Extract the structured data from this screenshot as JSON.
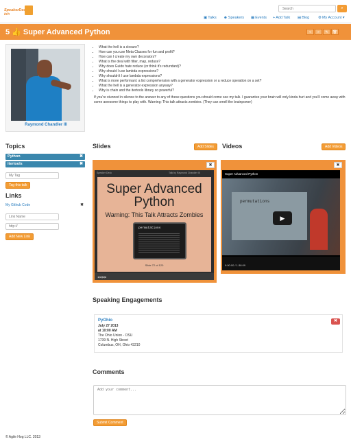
{
  "header": {
    "logo_text": "SpeakerDeck-ish",
    "search_placeholder": "Search",
    "search_icon": "magnifier-icon",
    "nav": [
      {
        "label": "Talks",
        "icon": "comments-icon"
      },
      {
        "label": "Speakers",
        "icon": "users-icon"
      },
      {
        "label": "Events",
        "icon": "calendar-icon"
      },
      {
        "label": "Add Talk",
        "icon": "plus-icon"
      },
      {
        "label": "Blog",
        "icon": "book-icon"
      },
      {
        "label": "My Account",
        "icon": "gear-icon"
      }
    ]
  },
  "title": {
    "text": "5 👍 Super Advanced Python",
    "actions": [
      "«",
      "»",
      "✎",
      "🗑"
    ]
  },
  "speaker": {
    "name": "Raymond Chandler III"
  },
  "abstract": {
    "bullets": [
      "What the hell is a closure?",
      "How can you use Meta Classes for fun and profit?",
      "How can I create my own decorators?",
      "What is the deal with filter, map, reduce?",
      "Why does Guido hate reduce (or think it's redundant)?",
      "Why should I use lambda expressions?",
      "Why shouldn't I use lambda expressions?",
      "What is more performant: a list comprehension with a generator expression or a reduce operation on a set?",
      "What the hell is a generator expression anyway?",
      "Why is chain and the itertools library so powerful?"
    ],
    "paragraph": "If you're stunned in silence to the answer to any of these questions you should come see my talk. I guarantee your brain will only kinda hurt and you'll come away with some awesome things to play with. Warning: This talk attracts zombies. (They can smell the brainpower)"
  },
  "topics": {
    "heading": "Topics",
    "items": [
      "Python",
      "itertools"
    ],
    "tag_placeholder": "My Tag",
    "tag_button": "Tag this talk"
  },
  "links": {
    "heading": "Links",
    "items": [
      "My Github Code"
    ],
    "name_placeholder": "Link Name",
    "url_placeholder": "http://",
    "add_button": "Add New Link"
  },
  "slides": {
    "heading": "Slides",
    "add_button": "Add Slides",
    "provider": "Speaker Deck",
    "by_text": "Talk by Raymond Chandler III",
    "slide_title": "Super Advanced Python",
    "slide_subtitle": "Warning: This Talk Attracts Zombies",
    "terminal_text": "permutations",
    "counter": "Slide 72 of 120"
  },
  "videos": {
    "heading": "Videos",
    "add_button": "Add Videos",
    "video_title": "Super Advanced Python",
    "screen_text": "permutations",
    "time": "9:00:00 / 1:38:09"
  },
  "engagements": {
    "heading": "Speaking Engagements",
    "items": [
      {
        "event": "PyOhio",
        "date": "July 27 2013",
        "time": "at 10:00 AM",
        "venue": "The Ohio Union - OSU",
        "street": "1739 N. High Street",
        "city": "Columbus, OH, Ohio 43210"
      }
    ]
  },
  "comments": {
    "heading": "Comments",
    "placeholder": "Add your comment...",
    "submit": "Submit Comment"
  },
  "footer": "© Agile Hog LLC. 2013",
  "colors": {
    "accent": "#f0923a",
    "link": "#2a7dbf",
    "tag": "#3a87ad",
    "danger": "#d9534f"
  }
}
